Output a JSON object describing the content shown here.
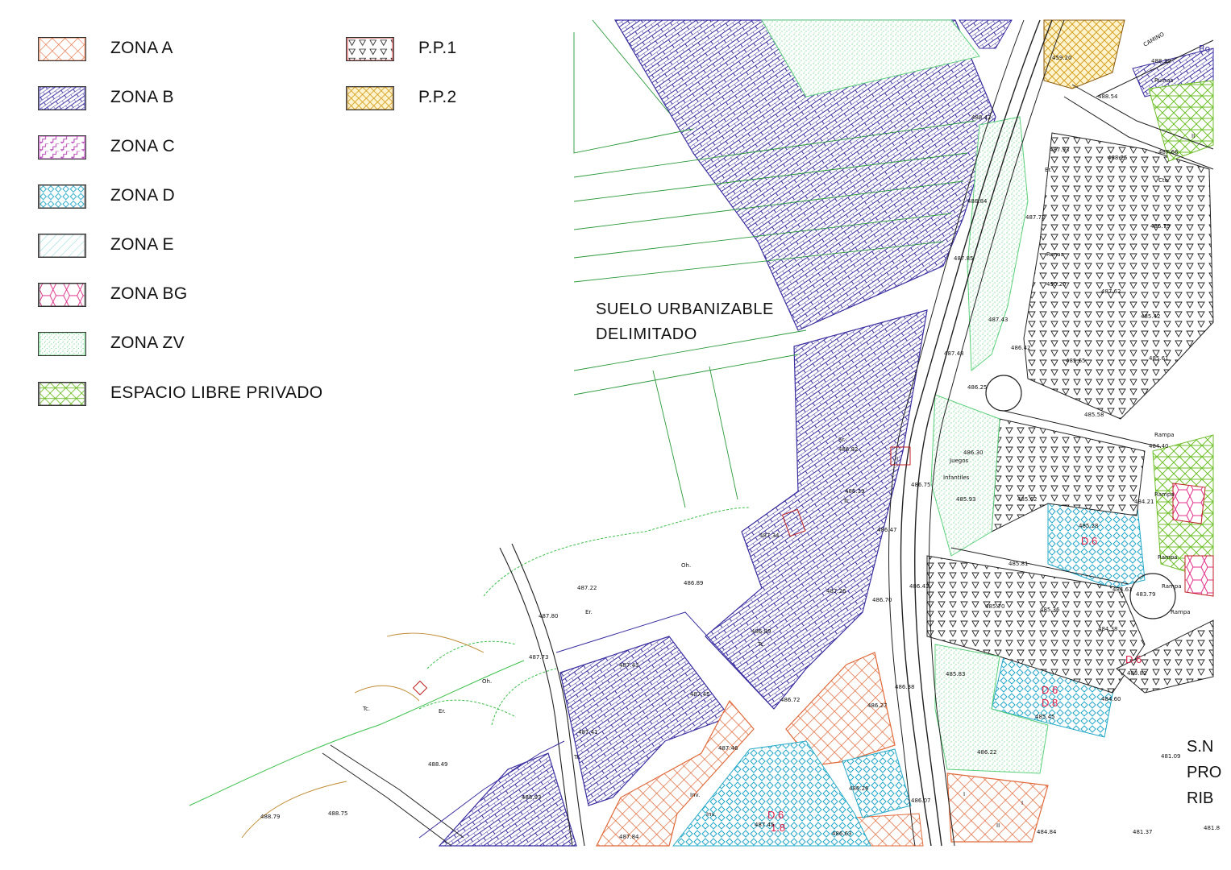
{
  "legend": {
    "left_items": [
      {
        "label": "ZONA A",
        "pattern": "zona-a",
        "color": "#e06a3a"
      },
      {
        "label": "ZONA B",
        "pattern": "zona-b",
        "color": "#3a2fa0"
      },
      {
        "label": "ZONA C",
        "pattern": "zona-c",
        "color": "#b02fb0"
      },
      {
        "label": "ZONA D",
        "pattern": "zona-d",
        "color": "#22a8c8"
      },
      {
        "label": "ZONA E",
        "pattern": "zona-e",
        "color": "#7fd6d6"
      },
      {
        "label": "ZONA BG",
        "pattern": "zona-bg",
        "color": "#e0308a"
      },
      {
        "label": "ZONA ZV",
        "pattern": "zona-zv",
        "color": "#5ad07a"
      },
      {
        "label": "ESPACIO LIBRE PRIVADO",
        "pattern": "espacio-libre",
        "color": "#6fbf2a"
      }
    ],
    "right_items": [
      {
        "label": "P.P.1",
        "pattern": "pp1",
        "color": "#c02020"
      },
      {
        "label": "P.P.2",
        "pattern": "pp2",
        "color": "#d4a020"
      }
    ]
  },
  "map": {
    "suelo_label_line1": "SUELO URBANIZABLE",
    "suelo_label_line2": "DELIMITADO",
    "sn_label_line1": "S.N",
    "sn_label_line2": "PRO",
    "sn_label_line3": "RIB",
    "camino_label": "CAMINO",
    "zone_codes": [
      "D.6",
      "D.6",
      "D.8",
      "D.6",
      "1.8",
      "D.6"
    ],
    "elevations": [
      "459.20",
      "488.39",
      "488.54",
      "488.42",
      "487.93",
      "488.25",
      "487.66",
      "488.84",
      "487.72",
      "486.79",
      "487.85",
      "490.20",
      "487.62",
      "485.42",
      "487.43",
      "486.42",
      "487.48",
      "485.65",
      "485.61",
      "486.25",
      "485.58",
      "486.82",
      "486.30",
      "484.40",
      "486.19",
      "486.75",
      "485.93",
      "485.62",
      "484.21",
      "487.34",
      "486.47",
      "485.28",
      "485.81",
      "487.22",
      "486.89",
      "486.43",
      "484.61",
      "483.79",
      "487.80",
      "486.70",
      "487.26",
      "485.70",
      "485.36",
      "484.38",
      "486.89",
      "487.73",
      "487.43",
      "485.83",
      "483.82",
      "486.38",
      "487.45",
      "486.72",
      "486.27",
      "484.60",
      "485.45",
      "487.41",
      "487.46",
      "486.22",
      "481.09",
      "488.49",
      "486.26",
      "488.79",
      "488.75",
      "488.93",
      "486.07",
      "487.45",
      "487.84",
      "486.63",
      "484.84",
      "481.37",
      "481.8"
    ],
    "small_labels": [
      "Runas",
      "Ruinas",
      "Cto.",
      "Juegos",
      "Infantiles",
      "Inv.",
      "Inv.",
      "Rampa",
      "Rampa",
      "Rampa",
      "Rampa",
      "Rampa",
      "Er.",
      "Er.",
      "Er.",
      "Oh.",
      "Oh.",
      "Tc.",
      "Tc.",
      "Tc.",
      "Tr.",
      "Sr.",
      "II",
      "II",
      "I",
      "I",
      "I",
      "Bo"
    ]
  }
}
